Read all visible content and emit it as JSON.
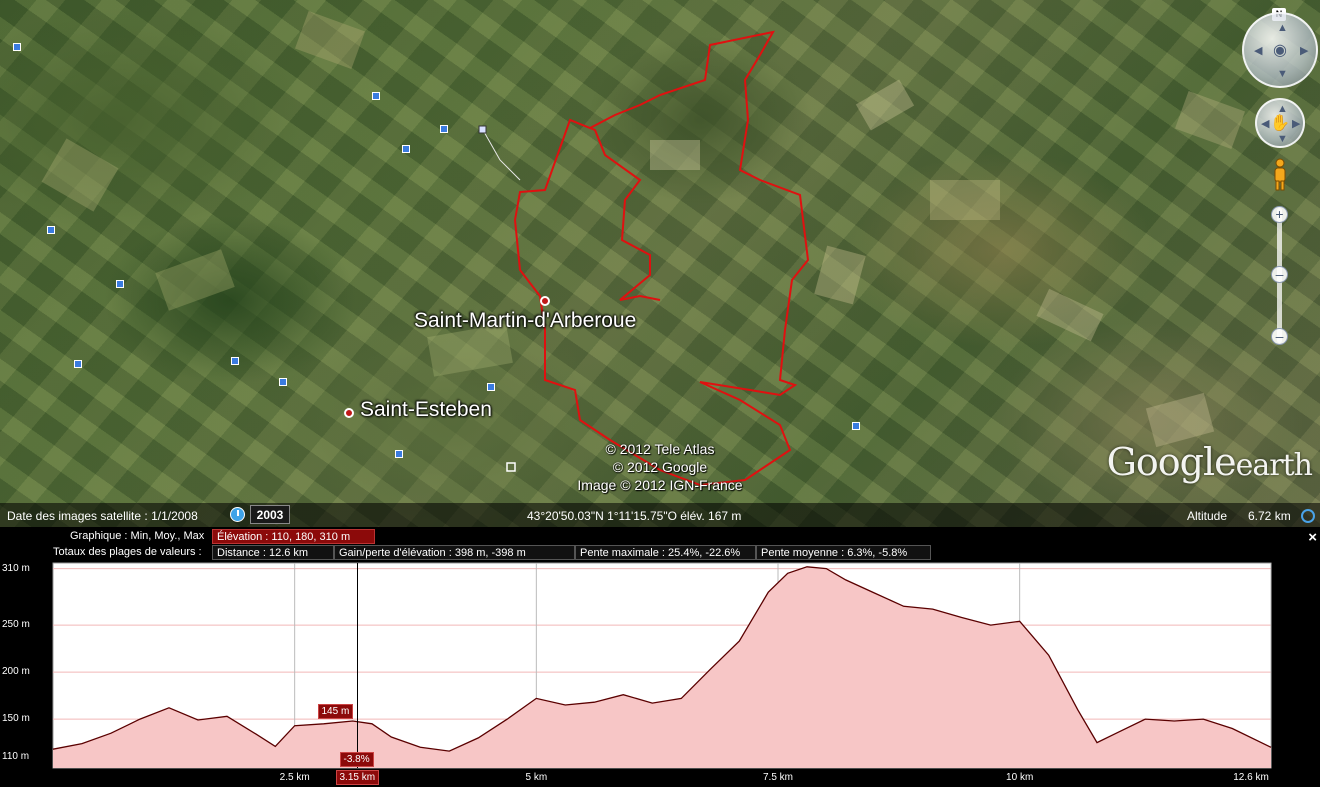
{
  "map": {
    "places": [
      {
        "name": "Saint-Martin-d'Arberoue"
      },
      {
        "name": "Saint-Esteben"
      }
    ],
    "copyright": [
      "© 2012 Tele Atlas",
      "© 2012 Google",
      "Image © 2012 IGN-France"
    ],
    "brand": {
      "main": "Google",
      "sub": "earth"
    },
    "north_label": "N",
    "colors": {
      "track": "#e01010",
      "profile_fill": "#f7c6c6",
      "profile_line": "#5a0000",
      "highlight": "#8c0a0a"
    }
  },
  "status": {
    "imagery_date": "Date des images satellite : 1/1/2008",
    "year": "2003",
    "coords": "43°20'50.03\"N    1°11'15.75\"O élév.   167 m",
    "altitude_label": "Altitude",
    "altitude_value": "6.72 km"
  },
  "profile": {
    "row1_label": "Graphique : Min, Moy., Max",
    "row1_value": "Élévation : 110, 180, 310 m",
    "row2_label": "Totaux des plages de valeurs :",
    "distance": "Distance : 12.6 km",
    "gain": "Gain/perte d'élévation : 398 m, -398 m",
    "max_slope": "Pente maximale : 25.4%, -22.6%",
    "avg_slope": "Pente moyenne : 6.3%, -5.8%",
    "close_label": "×",
    "cursor": {
      "elevation_label": "145 m",
      "slope_label": "-3.8%",
      "distance_label": "3.15 km",
      "distance_km": 3.15
    }
  },
  "chart_data": {
    "type": "area",
    "xlabel": "",
    "ylabel": "",
    "y_ticks": [
      {
        "value": 310,
        "label": "310 m"
      },
      {
        "value": 250,
        "label": "250 m"
      },
      {
        "value": 200,
        "label": "200 m"
      },
      {
        "value": 150,
        "label": "150 m"
      },
      {
        "value": 110,
        "label": "110 m"
      }
    ],
    "x_ticks": [
      {
        "value": 2.5,
        "label": "2.5 km"
      },
      {
        "value": 5,
        "label": "5 km"
      },
      {
        "value": 7.5,
        "label": "7.5 km"
      },
      {
        "value": 10,
        "label": "10 km"
      },
      {
        "value": 12.6,
        "label": "12.6 km"
      }
    ],
    "xlim": [
      0,
      12.6
    ],
    "ylim": [
      98,
      316
    ],
    "series": [
      {
        "x": [
          0,
          0.3,
          0.6,
          0.9,
          1.2,
          1.5,
          1.8,
          2.1,
          2.3,
          2.5,
          2.8,
          3.1,
          3.3,
          3.5,
          3.8,
          4.1,
          4.4,
          4.7,
          5.0,
          5.3,
          5.6,
          5.9,
          6.2,
          6.5,
          6.8,
          7.1,
          7.4,
          7.6,
          7.8,
          8.0,
          8.2,
          8.5,
          8.8,
          9.1,
          9.4,
          9.7,
          10.0,
          10.3,
          10.6,
          10.8,
          11.0,
          11.3,
          11.6,
          11.9,
          12.2,
          12.6
        ],
        "y": [
          118,
          124,
          135,
          150,
          162,
          149,
          153,
          134,
          121,
          143,
          145,
          148,
          145,
          131,
          120,
          116,
          130,
          150,
          172,
          165,
          168,
          176,
          167,
          172,
          203,
          233,
          285,
          305,
          312,
          310,
          298,
          284,
          270,
          267,
          258,
          250,
          254,
          218,
          160,
          125,
          135,
          150,
          148,
          150,
          140,
          120
        ]
      }
    ]
  }
}
